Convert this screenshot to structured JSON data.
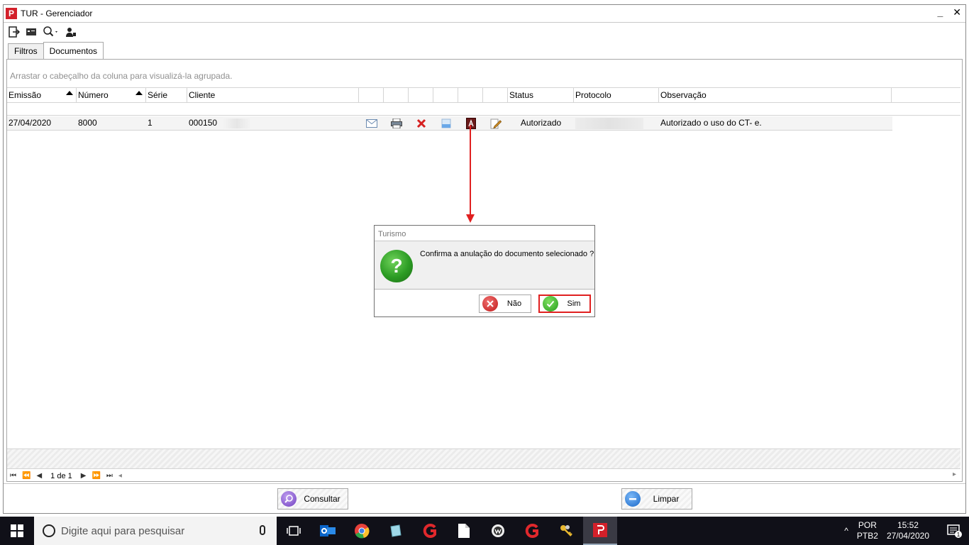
{
  "window": {
    "title": "TUR - Gerenciador",
    "minimize": "_",
    "close": "✕"
  },
  "toolbar": {
    "icons": [
      "exit-icon",
      "card-icon",
      "search-dropdown-icon",
      "user-icon"
    ]
  },
  "tabs": [
    {
      "label": "Filtros"
    },
    {
      "label": "Documentos",
      "active": true
    }
  ],
  "grid": {
    "group_hint": "Arrastar o cabeçalho da coluna para visualizá-la agrupada.",
    "columns": [
      "Emissão",
      "Número",
      "Série",
      "Cliente",
      "",
      "",
      "",
      "",
      "",
      "",
      "Status",
      "Protocolo",
      "Observação"
    ],
    "rows": [
      {
        "emissao": "27/04/2020",
        "numero": "8000",
        "serie": "1",
        "cliente": "000150",
        "status": "Autorizado",
        "protocolo": "",
        "observacao": "Autorizado o uso do CT- e."
      }
    ],
    "pager": {
      "text": "1 de 1"
    }
  },
  "buttons": {
    "consultar": "Consultar",
    "limpar": "Limpar"
  },
  "dialog": {
    "title": "Turismo",
    "message": "Confirma a anulação do documento selecionado ?",
    "no": "Não",
    "yes": "Sim"
  },
  "taskbar": {
    "search_placeholder": "Digite aqui para pesquisar",
    "lang_top": "POR",
    "lang_bottom": "PTB2",
    "time": "15:52",
    "date": "27/04/2020",
    "notification_count": "1"
  },
  "colors": {
    "accent_red": "#e02020",
    "app_red": "#d3202a",
    "taskbar": "#101018"
  }
}
